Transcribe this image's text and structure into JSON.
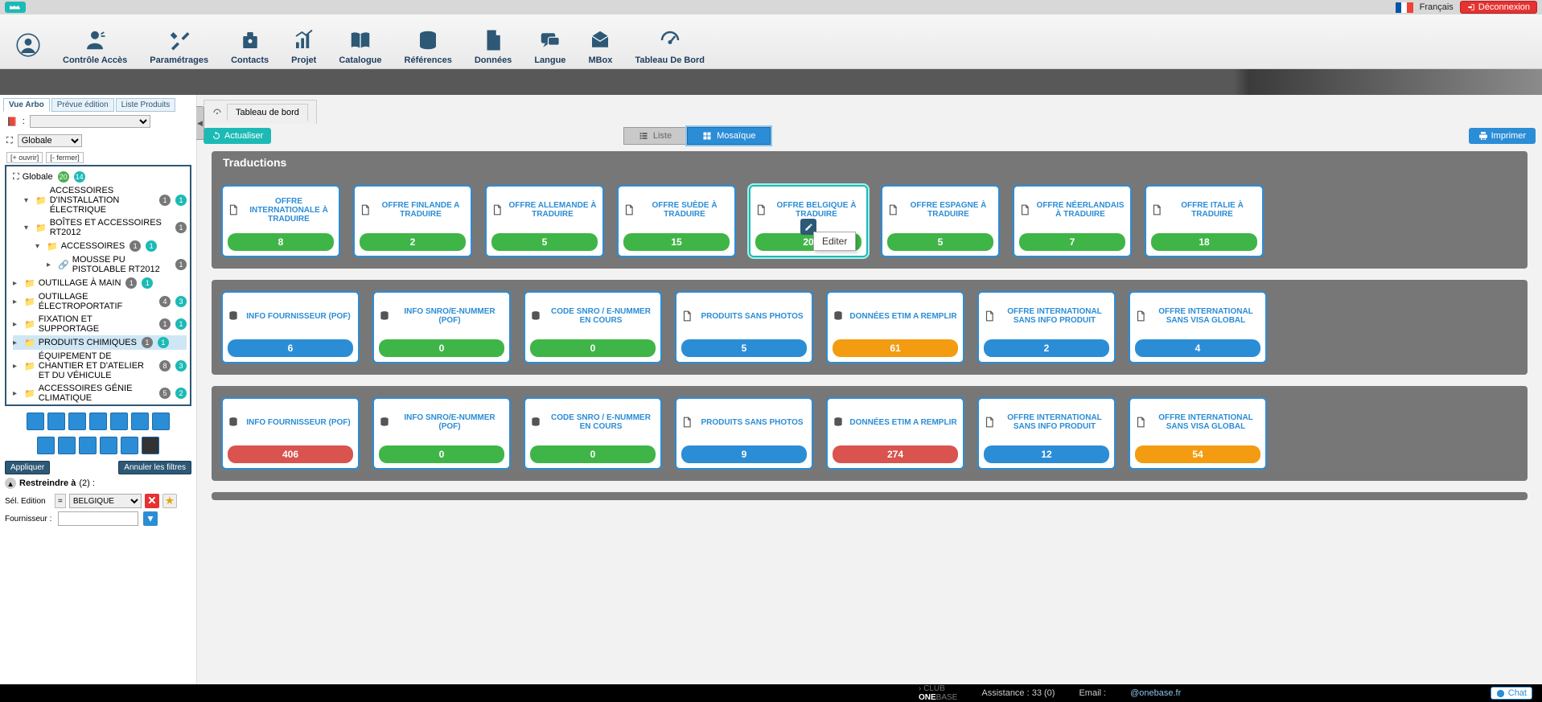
{
  "top": {
    "lang": "Français",
    "logout": "Déconnexion"
  },
  "nav": [
    "Contrôle Accès",
    "Paramétrages",
    "Contacts",
    "Projet",
    "Catalogue",
    "Références",
    "Données",
    "Langue",
    "MBox",
    "Tableau De Bord"
  ],
  "sidebar": {
    "tabs": [
      "Vue Arbo",
      "Prévue édition",
      "Liste Produits"
    ],
    "selector_placeholder": ":",
    "scope_label": "Globale",
    "open_all": "[+ ouvrir]",
    "close_all": "[- fermer]",
    "root": {
      "label": "Globale",
      "badge1": "20",
      "badge2": "14"
    },
    "tree": [
      {
        "label": "ACCESSOIRES D'INSTALLATION ÉLECTRIQUE",
        "b1": "1",
        "b2": "1",
        "indent": 1
      },
      {
        "label": "BOÎTES ET ACCESSOIRES RT2012",
        "b1": "1",
        "indent": 1
      },
      {
        "label": "ACCESSOIRES",
        "b1": "1",
        "b2": "1",
        "indent": 2
      },
      {
        "label": "MOUSSE PU PISTOLABLE RT2012",
        "b1": "1",
        "indent": 3,
        "link": true
      },
      {
        "label": "OUTILLAGE À MAIN",
        "b1": "1",
        "b2": "1",
        "indent": 0
      },
      {
        "label": "OUTILLAGE ÉLECTROPORTATIF",
        "b1": "4",
        "b2": "3",
        "indent": 0
      },
      {
        "label": "FIXATION ET SUPPORTAGE",
        "b1": "1",
        "b2": "1",
        "indent": 0
      },
      {
        "label": "PRODUITS CHIMIQUES",
        "b1": "1",
        "b2": "1",
        "indent": 0,
        "selected": true
      },
      {
        "label": "ÉQUIPEMENT DE CHANTIER ET D'ATELIER ET DU VÉHICULE",
        "b1": "8",
        "b2": "3",
        "indent": 0
      },
      {
        "label": "ACCESSOIRES GÉNIE CLIMATIQUE",
        "b1": "5",
        "b2": "2",
        "indent": 0
      }
    ],
    "apply": "Appliquer",
    "cancel_filters": "Annuler les filtres",
    "restrict": "Restreindre à",
    "restrict_count": "(2) :",
    "filter1_label": "Sél. Edition",
    "filter1_op": "=",
    "filter1_value": "BELGIQUE",
    "filter2_label": "Fournisseur :"
  },
  "page": {
    "tab_title": "Tableau de bord",
    "refresh": "Actualiser",
    "view_list": "Liste",
    "view_mosaic": "Mosaïque",
    "print": "Imprimer",
    "tooltip_edit": "Editer"
  },
  "sections": {
    "traductions": {
      "title": "Traductions",
      "cards": [
        {
          "title": "OFFRE INTERNATIONALE À TRADUIRE",
          "value": "8",
          "color": "green"
        },
        {
          "title": "OFFRE FINLANDE A TRADUIRE",
          "value": "2",
          "color": "green"
        },
        {
          "title": "OFFRE ALLEMANDE À TRADUIRE",
          "value": "5",
          "color": "green"
        },
        {
          "title": "OFFRE SUÈDE À TRADUIRE",
          "value": "15",
          "color": "green"
        },
        {
          "title": "OFFRE BELGIQUE À TRADUIRE",
          "value": "20",
          "color": "green",
          "highlight": true,
          "edit": true
        },
        {
          "title": "OFFRE ESPAGNE À TRADUIRE",
          "value": "5",
          "color": "green"
        },
        {
          "title": "OFFRE NÉERLANDAIS À TRADUIRE",
          "value": "7",
          "color": "green"
        },
        {
          "title": "OFFRE ITALIE À TRADUIRE",
          "value": "18",
          "color": "green"
        }
      ]
    },
    "group2": {
      "cards": [
        {
          "title": "INFO FOURNISSEUR (POF)",
          "value": "6",
          "color": "blue",
          "icon": "db"
        },
        {
          "title": "INFO SNRO/E-NUMMER (POF)",
          "value": "0",
          "color": "green",
          "icon": "db"
        },
        {
          "title": "CODE SNRO / E-NUMMER EN COURS",
          "value": "0",
          "color": "green",
          "icon": "db"
        },
        {
          "title": "PRODUITS SANS PHOTOS",
          "value": "5",
          "color": "blue",
          "icon": "doc"
        },
        {
          "title": "DONNÉES ETIM A REMPLIR",
          "value": "61",
          "color": "orange",
          "icon": "db"
        },
        {
          "title": "OFFRE INTERNATIONAL SANS INFO PRODUIT",
          "value": "2",
          "color": "blue",
          "icon": "doc"
        },
        {
          "title": "OFFRE INTERNATIONAL SANS VISA GLOBAL",
          "value": "4",
          "color": "blue",
          "icon": "doc"
        }
      ]
    },
    "group3": {
      "cards": [
        {
          "title": "INFO FOURNISSEUR (POF)",
          "value": "406",
          "color": "red",
          "icon": "db"
        },
        {
          "title": "INFO SNRO/E-NUMMER (POF)",
          "value": "0",
          "color": "green",
          "icon": "db"
        },
        {
          "title": "CODE SNRO / E-NUMMER EN COURS",
          "value": "0",
          "color": "green",
          "icon": "db"
        },
        {
          "title": "PRODUITS SANS PHOTOS",
          "value": "9",
          "color": "blue",
          "icon": "doc"
        },
        {
          "title": "DONNÉES ETIM A REMPLIR",
          "value": "274",
          "color": "red",
          "icon": "db"
        },
        {
          "title": "OFFRE INTERNATIONAL SANS INFO PRODUIT",
          "value": "12",
          "color": "blue",
          "icon": "doc"
        },
        {
          "title": "OFFRE INTERNATIONAL SANS VISA GLOBAL",
          "value": "54",
          "color": "orange",
          "icon": "doc"
        }
      ]
    }
  },
  "footer": {
    "assistance": "Assistance : 33 (0)",
    "email_label": "Email :",
    "email_value": "@onebase.fr",
    "chat": "Chat"
  }
}
